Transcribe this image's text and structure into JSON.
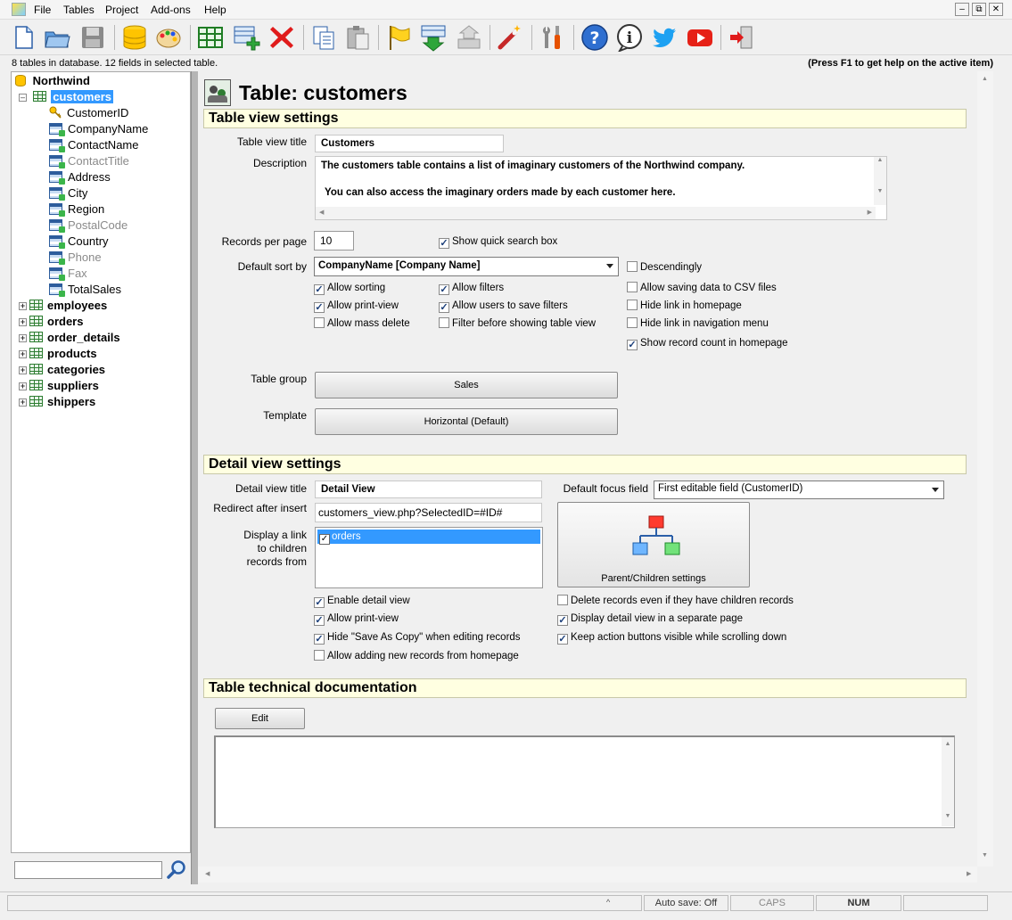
{
  "app": {
    "menu": [
      "File",
      "Tables",
      "Project",
      "Add-ons",
      "Help"
    ],
    "status_left": "8 tables in database. 12 fields in selected table.",
    "status_right": "(Press F1 to get help on the active item)"
  },
  "toolbar_icons": [
    "new-file-icon",
    "open-folder-icon",
    "save-disk-icon",
    "database-icon",
    "palette-icon",
    "table-grid-icon",
    "add-field-icon",
    "delete-x-icon",
    "copy-icon",
    "paste-icon",
    "flag-icon",
    "generate-icon",
    "upload-icon",
    "magic-wand-icon",
    "tools-icon",
    "help-icon",
    "info-icon",
    "twitter-icon",
    "youtube-icon",
    "exit-icon"
  ],
  "tree": {
    "root": "Northwind",
    "selected_table": "customers",
    "fields": [
      {
        "name": "CustomerID",
        "dim": false,
        "key": true
      },
      {
        "name": "CompanyName",
        "dim": false,
        "key": false
      },
      {
        "name": "ContactName",
        "dim": false,
        "key": false
      },
      {
        "name": "ContactTitle",
        "dim": true,
        "key": false
      },
      {
        "name": "Address",
        "dim": false,
        "key": false
      },
      {
        "name": "City",
        "dim": false,
        "key": false
      },
      {
        "name": "Region",
        "dim": false,
        "key": false
      },
      {
        "name": "PostalCode",
        "dim": true,
        "key": false
      },
      {
        "name": "Country",
        "dim": false,
        "key": false
      },
      {
        "name": "Phone",
        "dim": true,
        "key": false
      },
      {
        "name": "Fax",
        "dim": true,
        "key": false
      },
      {
        "name": "TotalSales",
        "dim": false,
        "key": false
      }
    ],
    "other_tables": [
      "employees",
      "orders",
      "order_details",
      "products",
      "categories",
      "suppliers",
      "shippers"
    ]
  },
  "page": {
    "title": "Table: customers"
  },
  "table_view": {
    "section_title": "Table view settings",
    "title_label": "Table view title",
    "title_value": "Customers",
    "description_label": "Description",
    "description_line1": "The customers table contains a list of imaginary customers of the Northwind company.",
    "description_line2": "You can also access the imaginary orders made by each customer here.",
    "records_label": "Records per page",
    "records_value": "10",
    "quick_search": "Show quick search box",
    "sort_label": "Default sort by",
    "sort_value": "CompanyName [Company Name]",
    "descending": "Descendingly",
    "checks": {
      "allow_sorting": "Allow sorting",
      "allow_filters": "Allow filters",
      "allow_csv": "Allow saving data to CSV files",
      "allow_print": "Allow print-view",
      "save_filters": "Allow users to save filters",
      "hide_home": "Hide link in homepage",
      "mass_delete": "Allow mass delete",
      "filter_first": "Filter before showing table view",
      "hide_nav": "Hide link in navigation menu",
      "record_count": "Show record count in homepage"
    },
    "group_label": "Table group",
    "group_value": "Sales",
    "template_label": "Template",
    "template_value": "Horizontal (Default)"
  },
  "detail_view": {
    "section_title": "Detail view settings",
    "title_label": "Detail view title",
    "title_value": "Detail View",
    "redirect_label": "Redirect after insert",
    "redirect_value": "customers_view.php?SelectedID=#ID#",
    "children_label1": "Display a link",
    "children_label2": "to children",
    "children_label3": "records from",
    "children_item": "orders",
    "focus_label": "Default focus field",
    "focus_value": "First editable field (CustomerID)",
    "parent_children_button": "Parent/Children settings",
    "checks": {
      "enable_detail": "Enable detail view",
      "delete_children": "Delete records even if they have children records",
      "print_view": "Allow print-view",
      "separate_page": "Display detail view in a separate page",
      "hide_save_copy": "Hide \"Save As Copy\" when editing records",
      "keep_buttons": "Keep action buttons visible while scrolling down",
      "add_from_home": "Allow adding new records from homepage"
    }
  },
  "tech_doc": {
    "section_title": "Table technical documentation",
    "edit_button": "Edit"
  },
  "statusbar": {
    "autosave": "Auto save: Off",
    "caps": "CAPS",
    "num": "NUM"
  },
  "colors": {
    "section_bg": "#ffffe1",
    "selection": "#3399ff"
  }
}
